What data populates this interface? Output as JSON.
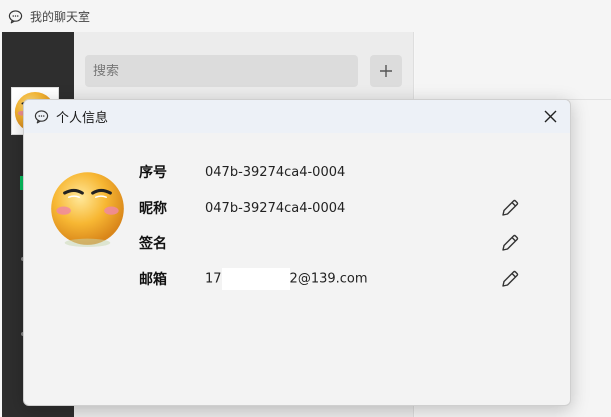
{
  "window": {
    "title": "我的聊天室",
    "icon": "chat-bubble-icon"
  },
  "sidebar": {
    "avatar": "smiley-avatar"
  },
  "search": {
    "placeholder": "搜索",
    "value": ""
  },
  "add_button": {
    "icon": "plus-icon"
  },
  "dialog": {
    "title": "个人信息",
    "icon": "chat-bubble-icon",
    "close_icon": "close-icon",
    "avatar": "smiley-avatar",
    "fields": [
      {
        "label": "序号",
        "value": "047b-39274ca4-0004",
        "editable": false
      },
      {
        "label": "昵称",
        "value": "047b-39274ca4-0004",
        "editable": true,
        "edit_icon": "pencil-icon"
      },
      {
        "label": "签名",
        "value": "",
        "editable": true,
        "edit_icon": "pencil-icon"
      },
      {
        "label": "邮箱",
        "value_prefix": "17",
        "value_suffix": "2@139.com",
        "masked": true,
        "editable": true,
        "edit_icon": "pencil-icon"
      }
    ]
  },
  "colors": {
    "sidebar": "#2e2e2e",
    "online_indicator": "#07c160",
    "dialog_header": "#edf1f7",
    "dialog_body": "#f3f3f3"
  }
}
